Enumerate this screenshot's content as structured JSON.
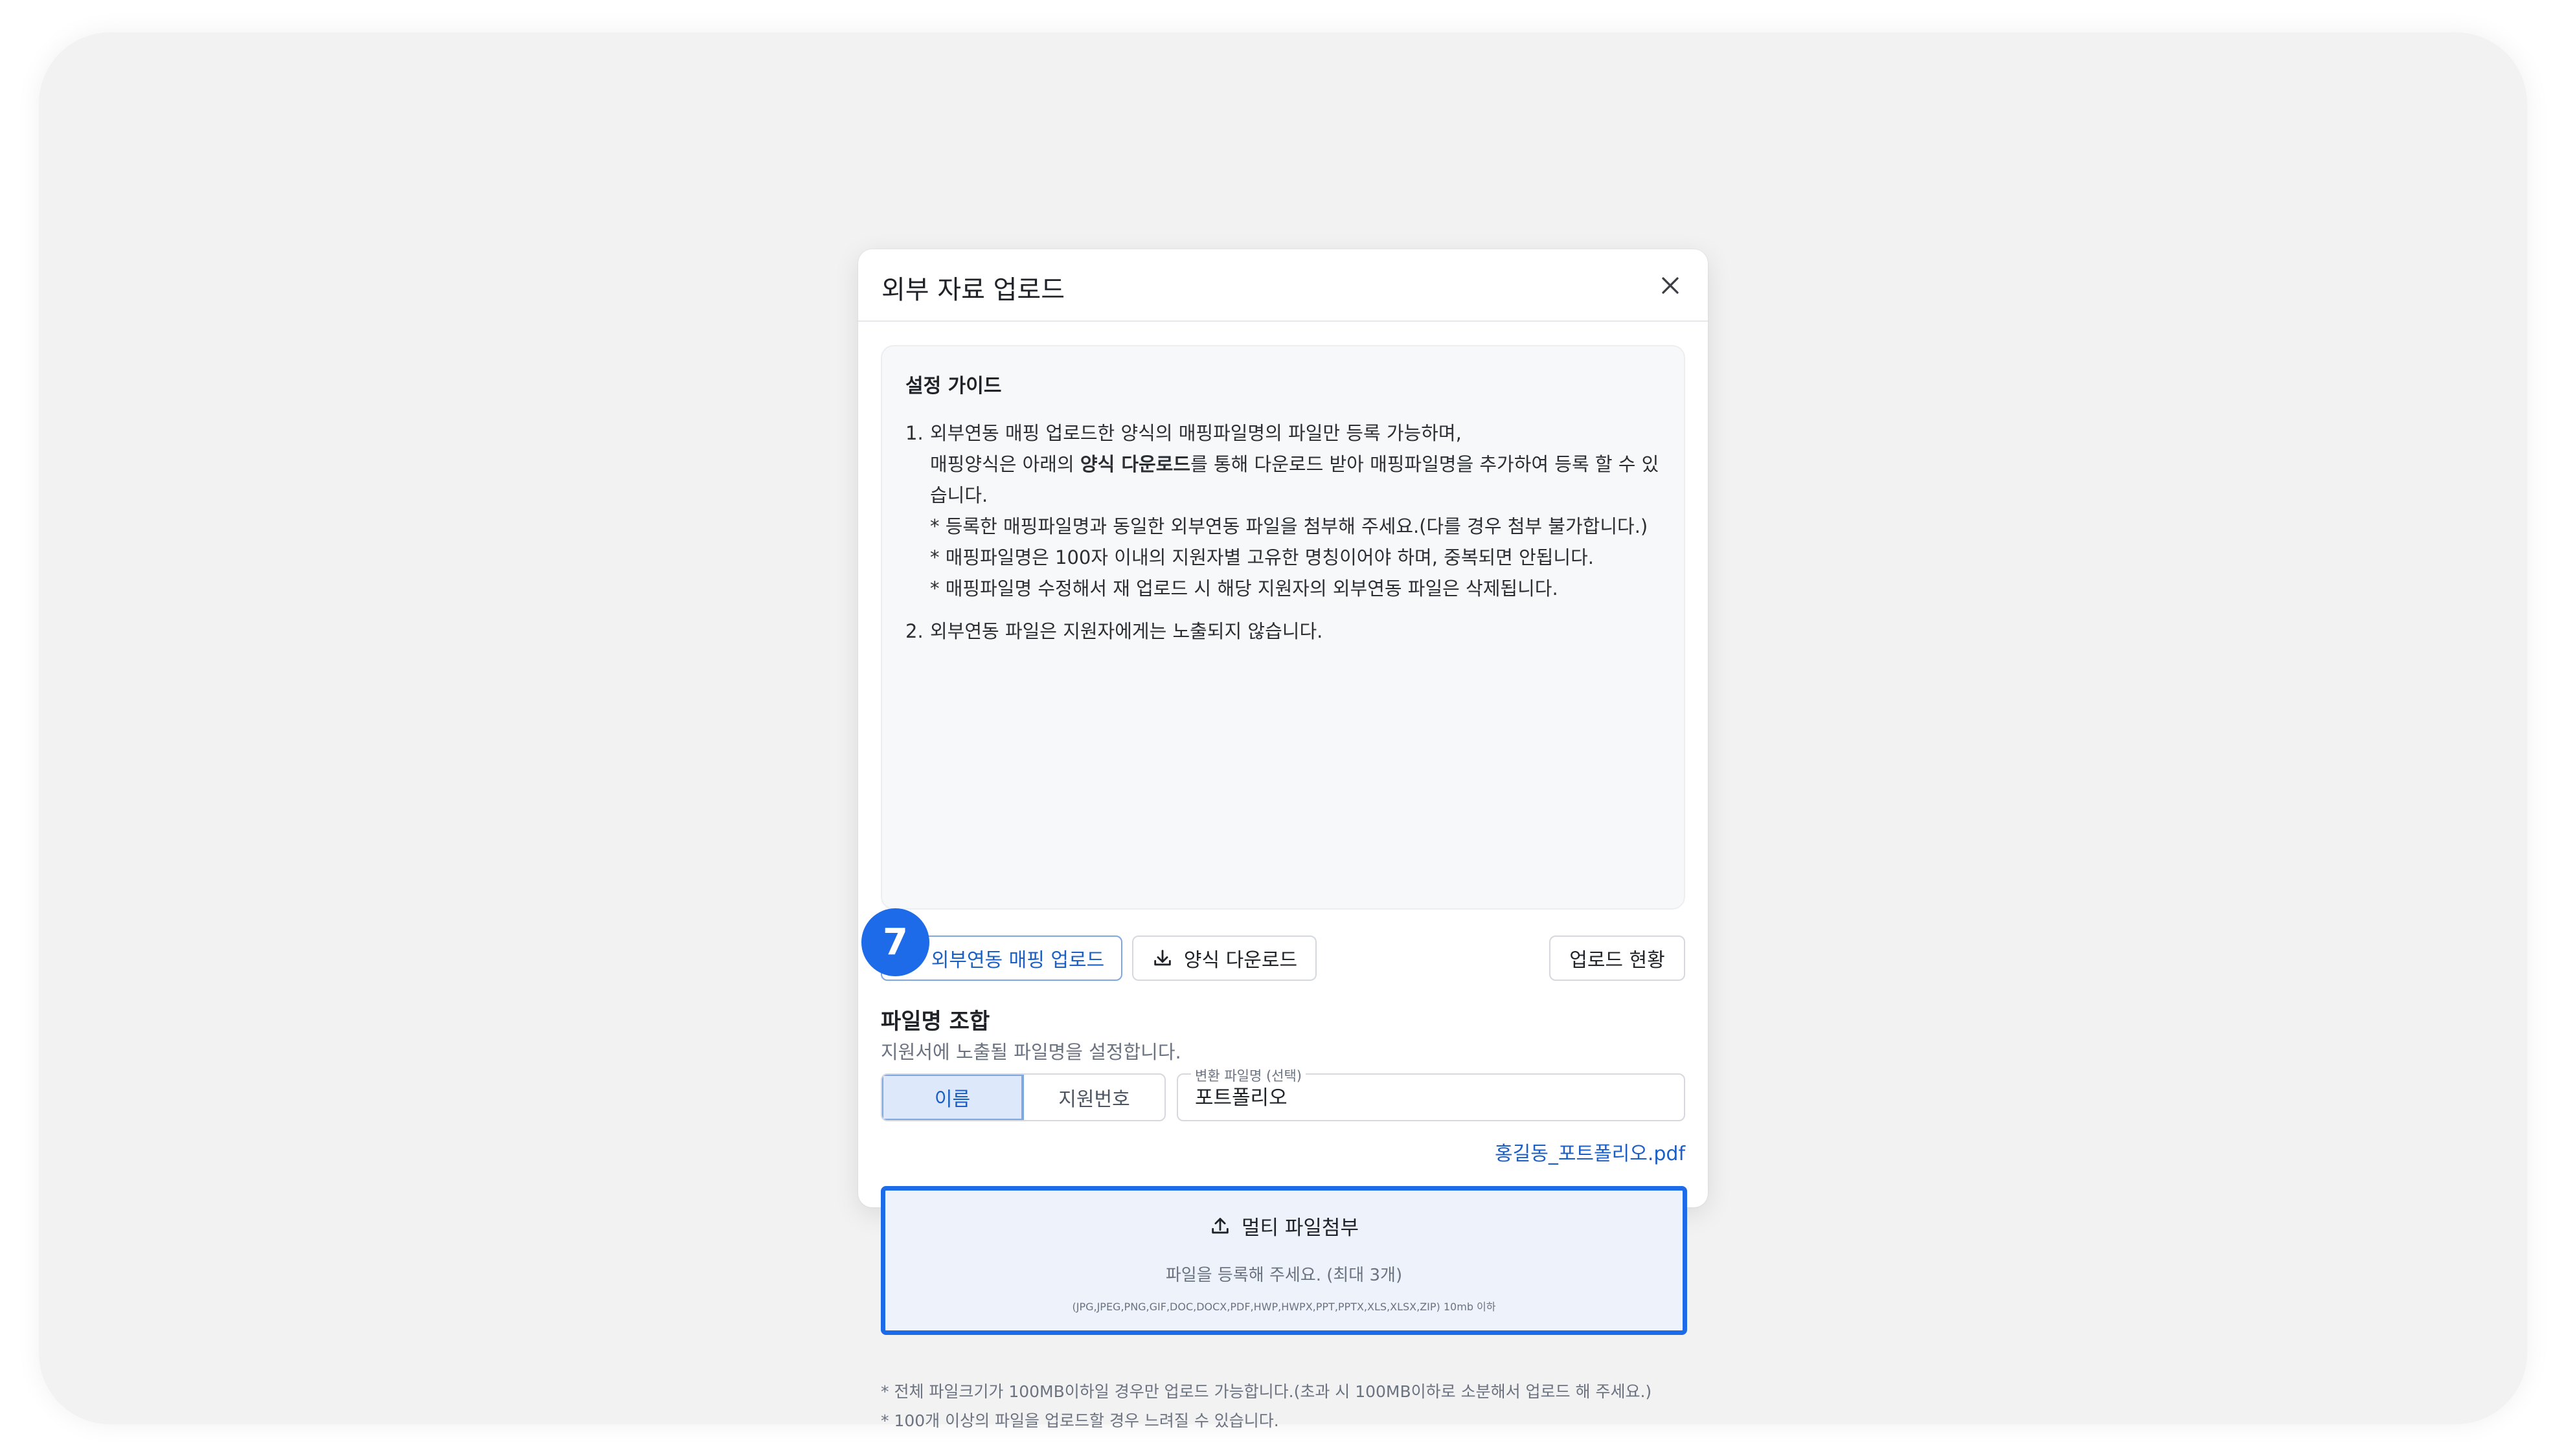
{
  "modal": {
    "title": "외부 자료 업로드",
    "close_icon": "close-icon"
  },
  "guide": {
    "title": "설정 가이드",
    "item1": {
      "num": "1.",
      "line1": "외부연동 매핑 업로드한 양식의 매핑파일명의 파일만 등록 가능하며,",
      "line2_prefix": "매핑양식은 아래의 ",
      "line2_bold": "양식 다운로드",
      "line2_suffix": "를 통해 다운로드 받아 매핑파일명을 추가하여 등록 할 수 있습니다.",
      "sub1": "* 등록한 매핑파일명과 동일한 외부연동 파일을 첨부해 주세요.(다를 경우 첨부 불가합니다.)",
      "sub2": "* 매핑파일명은 100자 이내의 지원자별 고유한 명칭이어야 하며, 중복되면 안됩니다.",
      "sub3": "* 매핑파일명 수정해서 재 업로드 시 해당 지원자의 외부연동 파일은 삭제됩니다."
    },
    "item2": {
      "num": "2.",
      "line1": "외부연동 파일은 지원자에게는 노출되지 않습니다."
    }
  },
  "buttons": {
    "upload_mapping": "외부연동 매핑 업로드",
    "download_form": "양식 다운로드",
    "upload_status": "업로드 현황"
  },
  "filename": {
    "title": "파일명 조합",
    "desc": "지원서에 노출될 파일명을 설정합니다.",
    "options": [
      "이름",
      "지원번호"
    ],
    "selected": "이름",
    "field_label": "변환 파일명 (선택)",
    "field_value": "포트폴리오",
    "preview": "홍길동_포트폴리오.pdf"
  },
  "dropzone": {
    "label": "멀티 파일첨부",
    "desc": "파일을 등록해 주세요. (최대 3개)",
    "types": "(JPG,JPEG,PNG,GIF,DOC,DOCX,PDF,HWP,HWPX,PPT,PPTX,XLS,XLSX,ZIP) 10mb 이하"
  },
  "step_badge": "7",
  "notes": [
    "* 전체 파일크기가 100MB이하일 경우만 업로드 가능합니다.(초과 시 100MB이하로 소분해서 업로드 해 주세요.)",
    "* 100개 이상의 파일을 업로드할 경우 느려질 수 있습니다."
  ],
  "colors": {
    "accent": "#1d6be8",
    "link": "#1b5fc4",
    "selected_bg": "#dde8fb",
    "dropzone_bg": "#eef3fb"
  }
}
